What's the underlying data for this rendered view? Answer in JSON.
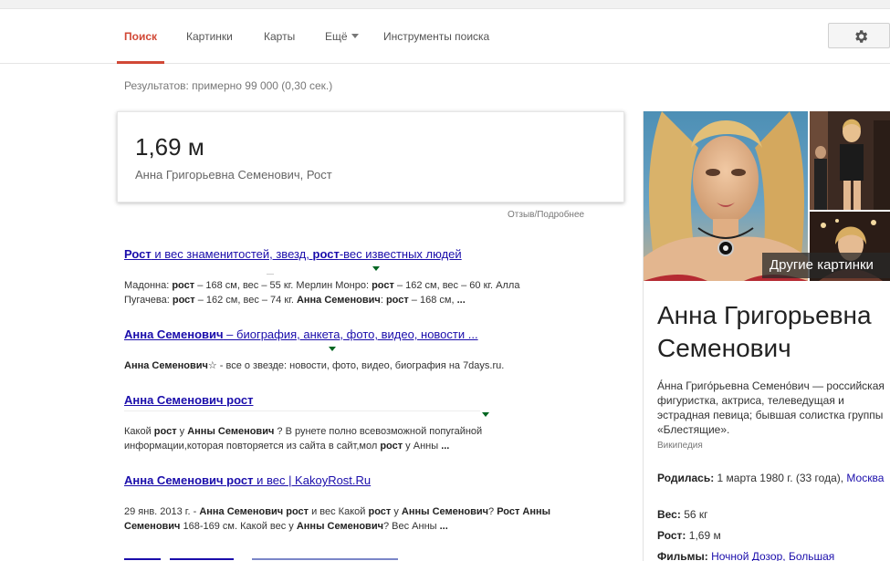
{
  "nav": {
    "tabs": [
      {
        "label": "Поиск",
        "active": true
      },
      {
        "label": "Картинки"
      },
      {
        "label": "Карты"
      },
      {
        "label": "Ещё"
      },
      {
        "label": "Инструменты поиска"
      }
    ],
    "settings_icon": "gear-icon"
  },
  "result_stats": "Результатов: примерно 99 000 (0,30 сек.)",
  "answer": {
    "value": "1,69 м",
    "subtitle": "Анна Григорьевна Семенович, Рост",
    "feedback": "Отзыв/Подробнее"
  },
  "results": [
    {
      "title_parts": [
        {
          "text": "Рост",
          "bold": true
        },
        {
          "text": " и вес знаменитостей, звезд, ",
          "bold": false
        },
        {
          "text": "рост",
          "bold": true
        },
        {
          "text": "-вес известных людей",
          "bold": false
        }
      ],
      "snippet_lines": [
        [
          {
            "text": "Мадонна: ",
            "bold": false
          },
          {
            "text": "рост",
            "bold": true
          },
          {
            "text": " – 168 см, вес – 55 кг. Мерлин Монро: ",
            "bold": false
          },
          {
            "text": "рост",
            "bold": true
          },
          {
            "text": " – 162 см, вес – 60 кг. Алла",
            "bold": false
          }
        ],
        [
          {
            "text": "Пугачева: ",
            "bold": false
          },
          {
            "text": "рост",
            "bold": true
          },
          {
            "text": " – 162 см, вес – 74 кг. ",
            "bold": false
          },
          {
            "text": "Анна Семенович",
            "bold": true
          },
          {
            "text": ": ",
            "bold": false
          },
          {
            "text": "рост",
            "bold": true
          },
          {
            "text": " – 168 см, ",
            "bold": false
          },
          {
            "text": "...",
            "bold": true
          }
        ]
      ]
    },
    {
      "title_parts": [
        {
          "text": "Анна Семенович",
          "bold": true
        },
        {
          "text": " – биография, анкета, фото, видео, новости ...",
          "bold": false
        }
      ],
      "snippet_lines": [
        [
          {
            "text": "Анна Семенович☆",
            "bold": true
          },
          {
            "text": " - все о звезде: новости, фото, видео, биография на 7days.ru.",
            "bold": false
          }
        ]
      ]
    },
    {
      "title_parts": [
        {
          "text": "Анна Семенович рост",
          "bold": true
        }
      ],
      "snippet_lines": [
        [
          {
            "text": "Какой ",
            "bold": false
          },
          {
            "text": "рост",
            "bold": true
          },
          {
            "text": " у ",
            "bold": false
          },
          {
            "text": "Анны Семенович",
            "bold": true
          },
          {
            "text": " ? В рунете полно всевозможной попугайной",
            "bold": false
          }
        ],
        [
          {
            "text": "информации,которая повторяется из сайта в сайт,мол ",
            "bold": false
          },
          {
            "text": "рост",
            "bold": true
          },
          {
            "text": " у Анны ",
            "bold": false
          },
          {
            "text": "...",
            "bold": true
          }
        ]
      ]
    },
    {
      "title_parts": [
        {
          "text": "Анна Семенович рост",
          "bold": true
        },
        {
          "text": " и вес | KakoyRost.Ru",
          "bold": false
        }
      ],
      "snippet_lines": [
        [
          {
            "text": "29 янв. 2013 г. - ",
            "bold": false
          },
          {
            "text": "Анна Семенович рост",
            "bold": true
          },
          {
            "text": " и вес Какой ",
            "bold": false
          },
          {
            "text": "рост",
            "bold": true
          },
          {
            "text": " у ",
            "bold": false
          },
          {
            "text": "Анны Семенович",
            "bold": true
          },
          {
            "text": "? ",
            "bold": false
          },
          {
            "text": "Рост Анны",
            "bold": true
          }
        ],
        [
          {
            "text": "Семенович",
            "bold": true
          },
          {
            "text": " 168-169 см. Какой вес у ",
            "bold": false
          },
          {
            "text": "Анны Семенович",
            "bold": true
          },
          {
            "text": "? Вес Анны ",
            "bold": false
          },
          {
            "text": "...",
            "bold": true
          }
        ]
      ]
    }
  ],
  "knowledge_panel": {
    "more_images": "Другие картинки",
    "title": "Анна Григорьевна Семенович",
    "description": "А́нна Григо́рьевна Семено́вич — российская фигуристка, актриса, телеведущая и эстрадная певица; бывшая солистка группы «Блестящие».",
    "source": "Википедия",
    "facts": [
      {
        "label": "Родилась:",
        "value": " 1 марта 1980 г. (33 года), ",
        "link": "Москва"
      },
      {
        "label": "Вес:",
        "value": " 56 кг",
        "link": ""
      },
      {
        "label": "Рост:",
        "value": " 1,69 м",
        "link": ""
      },
      {
        "label": "Фильмы:",
        "value": " ",
        "link": "Ночной Дозор, Большая"
      }
    ]
  }
}
